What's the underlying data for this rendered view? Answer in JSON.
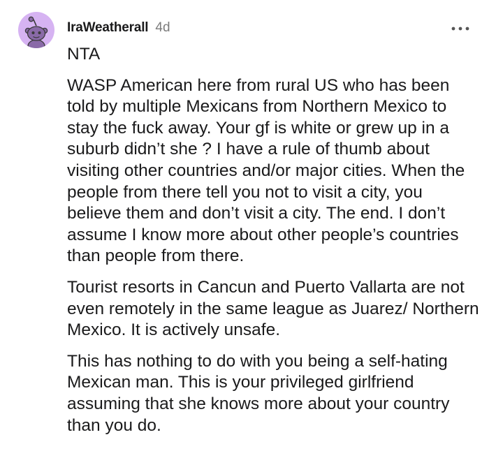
{
  "comment": {
    "author": "IraWeatherall",
    "age": "4d",
    "avatar_icon": "snoo-avatar-icon",
    "avatar_bg": "#d6b3f2",
    "more_icon": "more-horizontal-icon",
    "paragraphs": [
      "NTA",
      "WASP American here from rural US who has been told by multiple Mexicans from Northern Mexico to stay the fuck away. Your gf is white or grew up in a suburb didn’t she ? I have a rule of thumb about visiting other countries and/or major cities. When the people from there tell you not to visit a city, you believe them and don’t visit a city. The end. I don’t assume I know more about other people’s countries than people from there.",
      "Tourist resorts in Cancun and Puerto Vallarta are not even remotely in the same league as Juarez/ Northern Mexico. It is actively unsafe.",
      "This has nothing to do with you being a self-hating Mexican man. This is your privileged girlfriend assuming that she knows more about your country than you do."
    ]
  }
}
